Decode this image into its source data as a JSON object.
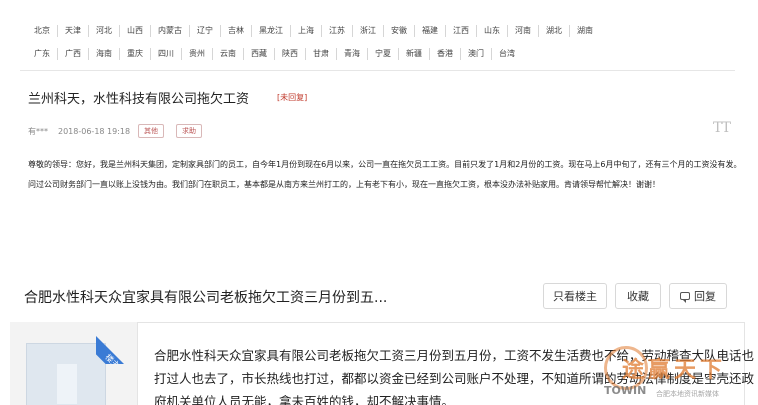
{
  "regions": {
    "row1": [
      "北京",
      "天津",
      "河北",
      "山西",
      "内蒙古",
      "辽宁",
      "吉林",
      "黑龙江",
      "上海",
      "江苏",
      "浙江",
      "安徽",
      "福建",
      "江西",
      "山东",
      "河南",
      "湖北",
      "湖南"
    ],
    "row2": [
      "广东",
      "广西",
      "海南",
      "重庆",
      "四川",
      "贵州",
      "云南",
      "西藏",
      "陕西",
      "甘肃",
      "青海",
      "宁夏",
      "新疆",
      "香港",
      "澳门",
      "台湾"
    ]
  },
  "post1": {
    "title": "兰州科天，水性科技有限公司拖欠工资",
    "status": "[未回复]",
    "user": "有***",
    "date": "2018-06-18 19:18",
    "tag1": "其他",
    "tag2": "求助",
    "corner_icon": "TT",
    "body": "尊敬的领导：您好，我是兰州科天集团，定制家具部门的员工，自今年1月份到现在6月以来，公司一直在拖欠员工工资。目前只发了1月和2月份的工资。现在马上6月中旬了，还有三个月的工资没有发。问过公司财务部门一直以账上没钱为由。我们部门在职员工，基本都是从南方来兰州打工的，上有老下有小，现在一直拖欠工资，根本没办法补贴家用。肯请领导帮忙解决！谢谢！"
  },
  "post2": {
    "title": "合肥水性科天众宜家具有限公司老板拖欠工资三月份到五...",
    "btn_only_op": "只看楼主",
    "btn_favorite": "收藏",
    "btn_reply": "回复",
    "ribbon": "楼主",
    "body": "合肥水性科天众宜家具有限公司老板拖欠工资三月份到五月份，工资不发生活费也不给，劳动稽查大队电话也打过人也去了，市长热线也打过，都都以资金已经到公司账户不处理，不知道所谓的劳动法律制度是空壳还政府机关单位人员无能，拿未百姓的钱，却不解决事情。"
  },
  "watermark": {
    "text": "途赢天下",
    "brand": "TOWIN",
    "sub": "合肥本地资讯新媒体"
  }
}
